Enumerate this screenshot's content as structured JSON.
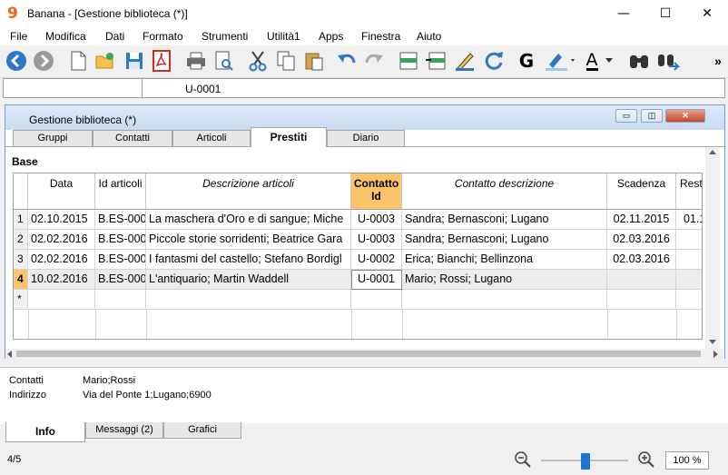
{
  "window": {
    "title": "Banana - [Gestione biblioteca (*)]",
    "app_icon_glyph": "9",
    "minimize_glyph": "—",
    "maximize_glyph": "☐",
    "close_glyph": "✕",
    "colors": {
      "accent": "#fbc46b",
      "icon_orange": "#e8641b",
      "toolbar_blue": "#1b74d0"
    }
  },
  "menu": [
    "File",
    "Modifica",
    "Dati",
    "Formato",
    "Strumenti",
    "Utilità1",
    "Apps",
    "Finestra",
    "Aiuto"
  ],
  "toolbar": {
    "icons": [
      "back-icon",
      "forward-icon",
      "new-file-icon",
      "open-folder-icon",
      "save-icon",
      "pdf-icon",
      "print-icon",
      "print-preview-icon",
      "cut-icon",
      "copy-icon",
      "paste-icon",
      "undo-icon",
      "redo-icon",
      "add-row-icon",
      "insert-rows-icon",
      "edit-pen-icon",
      "recalculate-icon",
      "bold-icon",
      "highlight-color-icon",
      "font-color-icon",
      "find-icon",
      "find-next-icon",
      "overflow-chevron-icon"
    ],
    "bold_glyph": "G",
    "font_color_glyph": "A",
    "overflow_glyph": "»"
  },
  "cellbar": {
    "value": "U-0001"
  },
  "document": {
    "title": "Gestione biblioteca (*)",
    "restore_glyph": "▭",
    "max_glyph": "◫",
    "close_glyph": "✕",
    "tabs": [
      "Gruppi",
      "Contatti",
      "Articoli",
      "Prestiti",
      "Diario"
    ],
    "active_tab": "Prestiti",
    "section": "Base",
    "columns": [
      "Data",
      "Id articoli",
      "Descrizione articoli",
      "Contatto\nId",
      "Contatto descrizione",
      "Scadenza",
      "Resti"
    ],
    "rows": [
      {
        "n": "1",
        "data": "02.10.2015",
        "id": "B.ES-000",
        "desc": "La maschera d'Oro e di sangue; Miche",
        "cid": "U-0003",
        "cdesc": "Sandra; Bernasconi; Lugano",
        "scad": "02.11.2015",
        "resti": "01.1"
      },
      {
        "n": "2",
        "data": "02.02.2016",
        "id": "B.ES-000",
        "desc": "Piccole storie sorridenti; Beatrice Gara",
        "cid": "U-0003",
        "cdesc": "Sandra; Bernasconi; Lugano",
        "scad": "02.03.2016",
        "resti": ""
      },
      {
        "n": "3",
        "data": "02.02.2016",
        "id": "B.ES-000",
        "desc": "I fantasmi del castello; Stefano Bordigl",
        "cid": "U-0002",
        "cdesc": "Erica; Bianchi; Bellinzona",
        "scad": "02.03.2016",
        "resti": ""
      },
      {
        "n": "4",
        "data": "10.02.2016",
        "id": "B.ES-000",
        "desc": "L'antiquario; Martin Waddell",
        "cid": "U-0001",
        "cdesc": "Mario; Rossi; Lugano",
        "scad": "",
        "resti": ""
      },
      {
        "n": "*",
        "data": "",
        "id": "",
        "desc": "",
        "cid": "",
        "cdesc": "",
        "scad": "",
        "resti": ""
      }
    ]
  },
  "info": {
    "contatti_label": "Contatti",
    "contatti_value": "Mario;Rossi",
    "indirizzo_label": "Indirizzo",
    "indirizzo_value": "Via del Ponte 1;Lugano;6900",
    "tabs": [
      "Info",
      "Messaggi (2)",
      "Grafici"
    ]
  },
  "status": {
    "row_position": "4/5",
    "zoom": "100 %",
    "zoom_level_percent": 100
  }
}
